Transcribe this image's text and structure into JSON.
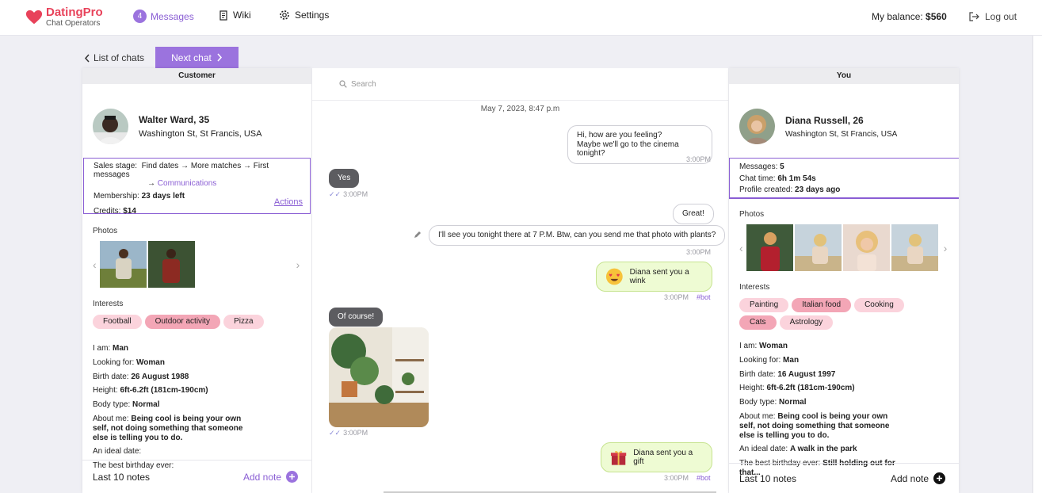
{
  "brand": {
    "name": "DatingPro",
    "subtitle": "Chat Operators"
  },
  "nav": {
    "messages_count": "4",
    "messages": "Messages",
    "wiki": "Wiki",
    "settings": "Settings"
  },
  "balance": {
    "label": "My balance:",
    "value": "$560"
  },
  "logout": "Log out",
  "subnav": {
    "back": "List of chats",
    "next": "Next chat"
  },
  "customer": {
    "header": "Customer",
    "name": "Walter Ward, 35",
    "address": "Washington St, St Francis, USA",
    "sales_stage_label": "Sales stage:",
    "sales_stage": "Find dates → More matches → First messages",
    "sales_stage_link": "Communications",
    "membership_label": "Membership:",
    "membership": "23 days left",
    "credits_label": "Credits:",
    "credits": "$14",
    "actions": "Actions",
    "photos_label": "Photos",
    "interests_label": "Interests",
    "interests": [
      {
        "label": "Football",
        "active": false
      },
      {
        "label": "Outdoor activity",
        "active": true
      },
      {
        "label": "Pizza",
        "active": false
      }
    ],
    "attrs": [
      {
        "label": "I am:",
        "value": "Man"
      },
      {
        "label": "Looking for:",
        "value": "Woman"
      },
      {
        "label": "Birth date:",
        "value": "26 August 1988"
      },
      {
        "label": "Height:",
        "value": "6ft-6.2ft (181cm-190cm)"
      },
      {
        "label": "Body type:",
        "value": "Normal"
      },
      {
        "label": "About me:",
        "value": "Being cool is being your own self, not doing something that someone else is telling you to do."
      },
      {
        "label": "An ideal date:",
        "value": ""
      },
      {
        "label": "The best birthday ever:",
        "value": ""
      }
    ],
    "notes_title": "Last 10 notes",
    "add_note": "Add note"
  },
  "chat": {
    "search_placeholder": "Search",
    "date": "May 7, 2023, 8:47 p.m",
    "messages": [
      {
        "text": "Hi, how are you feeling?\nMaybe we'll go to the cinema tonight?",
        "time": "3:00PM"
      },
      {
        "text": "Yes",
        "time": "3:00PM"
      },
      {
        "text": "Great!"
      },
      {
        "text": "I'll see you tonight there at 7 P.M. Btw, can you send me that photo with plants?",
        "time": "3:00PM"
      },
      {
        "text": "Diana sent you a wink",
        "time": "3:00PM",
        "tag": "#bot"
      },
      {
        "text": "Of course!",
        "time": "3:00PM"
      },
      {
        "text": "Diana sent you a gift",
        "time": "3:00PM",
        "tag": "#bot"
      }
    ]
  },
  "you": {
    "header": "You",
    "name": "Diana Russell, 26",
    "address": "Washington St, St Francis, USA",
    "messages_label": "Messages:",
    "messages": "5",
    "chat_time_label": "Chat time:",
    "chat_time": "6h 1m 54s",
    "profile_created_label": "Profile created:",
    "profile_created": "23 days ago",
    "photos_label": "Photos",
    "interests_label": "Interests",
    "interests": [
      {
        "label": "Painting",
        "active": false
      },
      {
        "label": "Italian food",
        "active": true
      },
      {
        "label": "Cooking",
        "active": false
      },
      {
        "label": "Cats",
        "active": true
      },
      {
        "label": "Astrology",
        "active": false
      }
    ],
    "attrs": [
      {
        "label": "I am:",
        "value": "Woman"
      },
      {
        "label": "Looking for:",
        "value": "Man"
      },
      {
        "label": "Birth date:",
        "value": "16 August 1997"
      },
      {
        "label": "Height:",
        "value": "6ft-6.2ft (181cm-190cm)"
      },
      {
        "label": "Body type:",
        "value": "Normal"
      },
      {
        "label": "About me:",
        "value": "Being cool is being your own self, not doing something that someone else is telling you to do."
      },
      {
        "label": "An ideal date:",
        "value": "A walk in the park"
      },
      {
        "label": "The best birthday ever:",
        "value": "Still holding out for that..."
      }
    ],
    "notes_title": "Last 10 notes",
    "add_note": "Add note"
  },
  "colors": {
    "accent": "#9b73de",
    "brand": "#e8425a",
    "tag": "#fbd3dc",
    "tag_active": "#f3a6b6",
    "event_bubble": "#eefbd3"
  }
}
